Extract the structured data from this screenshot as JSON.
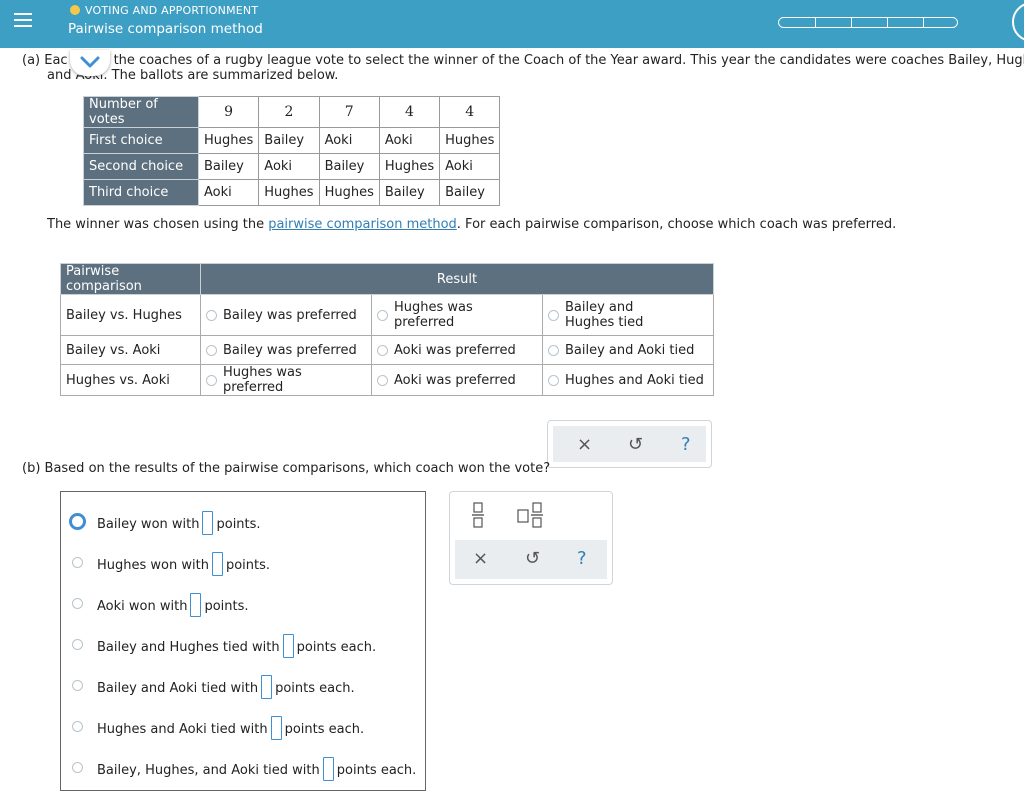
{
  "header": {
    "topic": "VOTING AND APPORTIONMENT",
    "title": "Pairwise comparison method"
  },
  "colors": {
    "header_bg": "#3e9fc4",
    "table_header_bg": "#5d707f",
    "selected_radio": "#3f8fd2",
    "link": "#2f7fb5"
  },
  "part_a": {
    "prefix": "(a) Eac",
    "line1_rest": "the coaches of a rugby league vote to select the winner of the Coach of the Year award. This year the candidates were coaches Bailey, Hughes,",
    "line2_prefix": "and",
    "line2_partial": "Aoki",
    "line2_rest": ". The ballots are summarized below."
  },
  "ballot_table": {
    "row_headers": [
      "Number of votes",
      "First choice",
      "Second choice",
      "Third choice"
    ],
    "votes": [
      "9",
      "2",
      "7",
      "4",
      "4"
    ],
    "first": [
      "Hughes",
      "Bailey",
      "Aoki",
      "Aoki",
      "Hughes"
    ],
    "second": [
      "Bailey",
      "Aoki",
      "Bailey",
      "Hughes",
      "Aoki"
    ],
    "third": [
      "Aoki",
      "Hughes",
      "Hughes",
      "Bailey",
      "Bailey"
    ]
  },
  "instruction": {
    "before": "The winner was chosen using the ",
    "link": "pairwise comparison method",
    "after": ". For each pairwise comparison, choose which coach was preferred."
  },
  "pairwise_table": {
    "headers": [
      "Pairwise comparison",
      "Result"
    ],
    "rows": [
      {
        "label": "Bailey vs. Hughes",
        "options": [
          "Bailey was preferred",
          "Hughes was preferred",
          "Bailey and Hughes tied"
        ]
      },
      {
        "label": "Bailey vs. Aoki",
        "options": [
          "Bailey was preferred",
          "Aoki was preferred",
          "Bailey and Aoki tied"
        ]
      },
      {
        "label": "Hughes vs. Aoki",
        "options": [
          "Hughes was preferred",
          "Aoki was preferred",
          "Hughes and Aoki tied"
        ]
      }
    ]
  },
  "toolbar": {
    "clear": "×",
    "undo": "↺",
    "help": "?"
  },
  "part_b": {
    "question": "(b) Based on the results of the pairwise comparisons, which coach won the vote?",
    "options": [
      {
        "before": "Bailey won with",
        "after": "points."
      },
      {
        "before": "Hughes won with",
        "after": "points."
      },
      {
        "before": "Aoki won with",
        "after": "points."
      },
      {
        "before": "Bailey and Hughes tied with",
        "after": "points each."
      },
      {
        "before": "Bailey and Aoki tied with",
        "after": "points each."
      },
      {
        "before": "Hughes and Aoki tied with",
        "after": "points each."
      },
      {
        "before": "Bailey, Hughes, and Aoki tied with",
        "after": "points each."
      }
    ],
    "selected_index": 0
  }
}
